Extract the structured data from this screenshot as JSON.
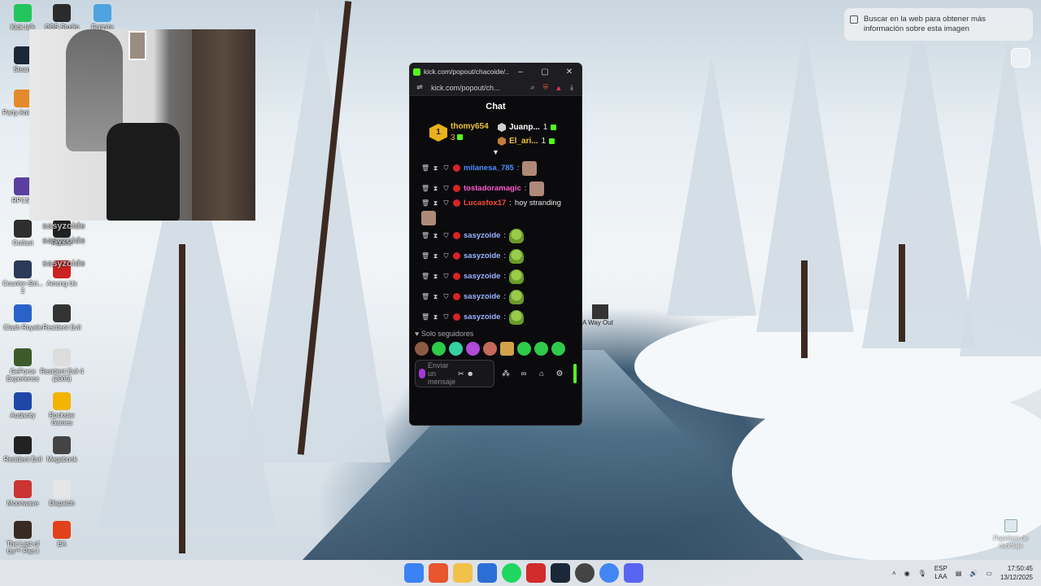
{
  "desktop": {
    "icons": [
      {
        "label": "Kick talk",
        "color": "#22c55e"
      },
      {
        "label": "OBS Studio",
        "color": "#2b2b2b"
      },
      {
        "label": "Fortnite",
        "color": "#4fa3e0"
      },
      {
        "label": "Steam",
        "color": "#1b2838"
      },
      {
        "label": "Party Anima...",
        "color": "#e48a2b"
      },
      {
        "label": "RPCS3",
        "color": "#5a3fa0"
      },
      {
        "label": "Outlast",
        "color": "#2e2e2e"
      },
      {
        "label": "Roblox",
        "color": "#222"
      },
      {
        "label": "Counter-Stri... 2",
        "color": "#2a3b5a"
      },
      {
        "label": "Among Us",
        "color": "#c22"
      },
      {
        "label": "Clash Royale",
        "color": "#2a62c9"
      },
      {
        "label": "Resident Evil",
        "color": "#333"
      },
      {
        "label": "GeForce Experience",
        "color": "#3b5c2a"
      },
      {
        "label": "Resident Evil 4 (2005)",
        "color": "#ddd"
      },
      {
        "label": "Audacity",
        "color": "#1f47a8"
      },
      {
        "label": "Rockstar Games",
        "color": "#f2b400"
      },
      {
        "label": "Resident Evil",
        "color": "#222"
      },
      {
        "label": "Megabonk",
        "color": "#444"
      },
      {
        "label": "Moonwave",
        "color": "#c33"
      },
      {
        "label": "Dispatch",
        "color": "#e6e6e6"
      },
      {
        "label": "The Last of Us™ Part I",
        "color": "#3a2a22"
      },
      {
        "label": "EA",
        "color": "#e2421b"
      }
    ],
    "stream_overlay_lines": [
      "sasyzoide",
      "sasyzoide",
      "sasyzoide"
    ],
    "way_out_label": "A Way Out",
    "recycle_bin_label": "Papelera de reciclaje"
  },
  "lens": {
    "tooltip": "Buscar en la web para obtener más información sobre esta imagen"
  },
  "popup": {
    "title": "kick.com/popout/chacoide/...",
    "url": "kick.com/popout/ch...",
    "chat_header": "Chat",
    "leaderboard": {
      "first": {
        "rank": "1",
        "name": "thomy654",
        "count": "3"
      },
      "second": {
        "name": "Juanp...",
        "count": "1"
      },
      "third": {
        "name": "El_ari...",
        "count": "1"
      }
    },
    "messages": [
      {
        "user": "milanesa_785",
        "text": "",
        "color": "#4c8cff"
      },
      {
        "user": "tostadoramagic",
        "text": "",
        "color": "#ff5ad1"
      },
      {
        "user": "Lucasfox17",
        "text": "hoy stranding",
        "color": "#ff4b3e"
      },
      {
        "user": "sasyzoide",
        "text": "",
        "color": "#9ab4ff"
      },
      {
        "user": "sasyzoide",
        "text": "",
        "color": "#9ab4ff"
      },
      {
        "user": "sasyzoide",
        "text": "",
        "color": "#9ab4ff"
      },
      {
        "user": "sasyzoide",
        "text": "",
        "color": "#9ab4ff"
      },
      {
        "user": "sasyzoide",
        "text": "",
        "color": "#9ab4ff"
      }
    ],
    "followers_only": "Solo seguidores",
    "input_placeholder": "Enviar un mensaje"
  },
  "taskbar": {
    "language": "ESP",
    "layout": "LAA",
    "time": "17:50:45",
    "date": "13/12/2025"
  }
}
